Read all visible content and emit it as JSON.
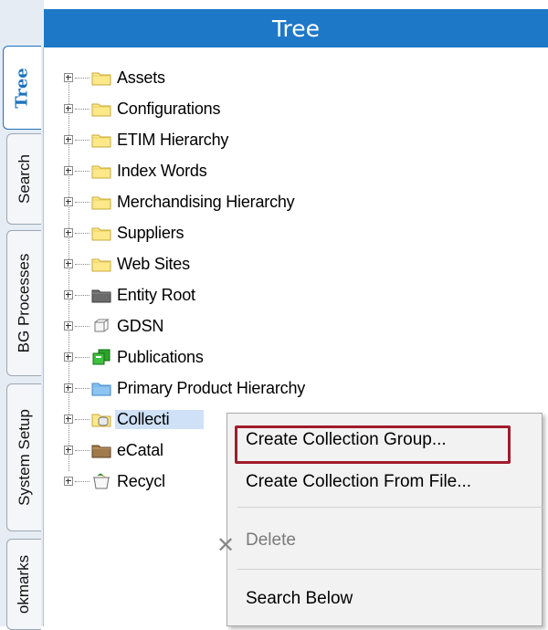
{
  "header": {
    "title": "Tree"
  },
  "tabs": [
    {
      "label": "Tree",
      "active": true
    },
    {
      "label": "Search",
      "active": false
    },
    {
      "label": "BG Processes",
      "active": false
    },
    {
      "label": "System Setup",
      "active": false
    },
    {
      "label": "okmarks",
      "active": false
    }
  ],
  "tree": {
    "nodes": [
      {
        "label": "Assets",
        "icon": "folder-icon"
      },
      {
        "label": "Configurations",
        "icon": "folder-icon"
      },
      {
        "label": "ETIM Hierarchy",
        "icon": "folder-icon"
      },
      {
        "label": "Index Words",
        "icon": "folder-icon"
      },
      {
        "label": "Merchandising Hierarchy",
        "icon": "folder-icon"
      },
      {
        "label": "Suppliers",
        "icon": "folder-icon"
      },
      {
        "label": "Web Sites",
        "icon": "folder-icon"
      },
      {
        "label": "Entity Root",
        "icon": "dark-folder-icon"
      },
      {
        "label": "GDSN",
        "icon": "cube-icon"
      },
      {
        "label": "Publications",
        "icon": "publications-icon"
      },
      {
        "label": "Primary Product Hierarchy",
        "icon": "blue-folder-icon"
      },
      {
        "label": "Collecti",
        "icon": "collection-icon",
        "selected": true
      },
      {
        "label": "eCatal",
        "icon": "catalog-folder-icon"
      },
      {
        "label": "Recycl",
        "icon": "recycle-bin-icon"
      }
    ]
  },
  "context_menu": {
    "items": [
      {
        "label": "Create Collection Group...",
        "enabled": true,
        "highlighted": true
      },
      {
        "label": "Create Collection From File...",
        "enabled": true
      },
      {
        "label": "Delete",
        "enabled": false,
        "icon": "delete-x-icon"
      },
      {
        "label": "Search Below",
        "enabled": true
      }
    ]
  },
  "colors": {
    "header_bg": "#1e78c8",
    "highlight_border": "#a01c2c",
    "selection_bg": "#cfe1f7"
  }
}
